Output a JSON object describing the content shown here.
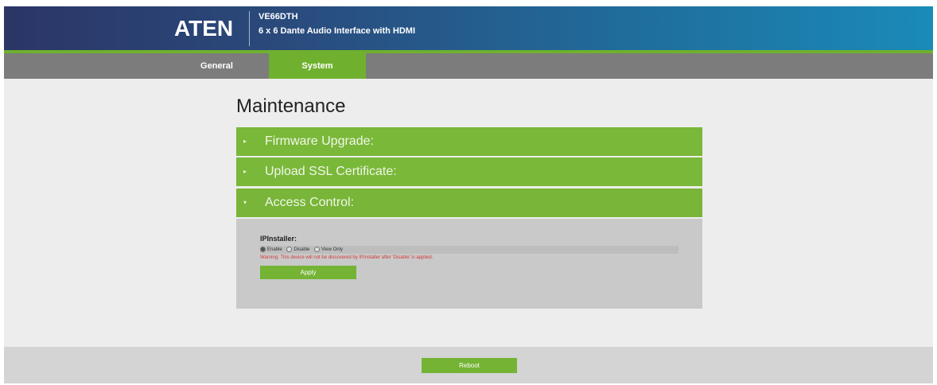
{
  "header": {
    "logo": "ATEN",
    "model": "VE66DTH",
    "product": "6 x 6 Dante Audio Interface with HDMI"
  },
  "nav": {
    "tabs": [
      {
        "label": "General",
        "active": false
      },
      {
        "label": "System",
        "active": true
      }
    ]
  },
  "main": {
    "title": "Maintenance",
    "sections": [
      {
        "label": "Firmware Upgrade:",
        "expanded": false
      },
      {
        "label": "Upload SSL Certificate:",
        "expanded": false
      },
      {
        "label": "Access Control:",
        "expanded": true
      }
    ],
    "access_control": {
      "ipinstaller_label": "IPInstaller:",
      "options": [
        {
          "label": "Enable",
          "selected": true
        },
        {
          "label": "Disable",
          "selected": false
        },
        {
          "label": "View Only",
          "selected": false
        }
      ],
      "warning": "Warning: This device will not be discovered by IPInstaller after 'Disable' is applied.",
      "apply_label": "Apply"
    }
  },
  "footer": {
    "reboot_label": "Reboot"
  },
  "colors": {
    "accent_green": "#6fb12e",
    "header_dark": "#2b3566",
    "warning_red": "#d43a3a"
  }
}
